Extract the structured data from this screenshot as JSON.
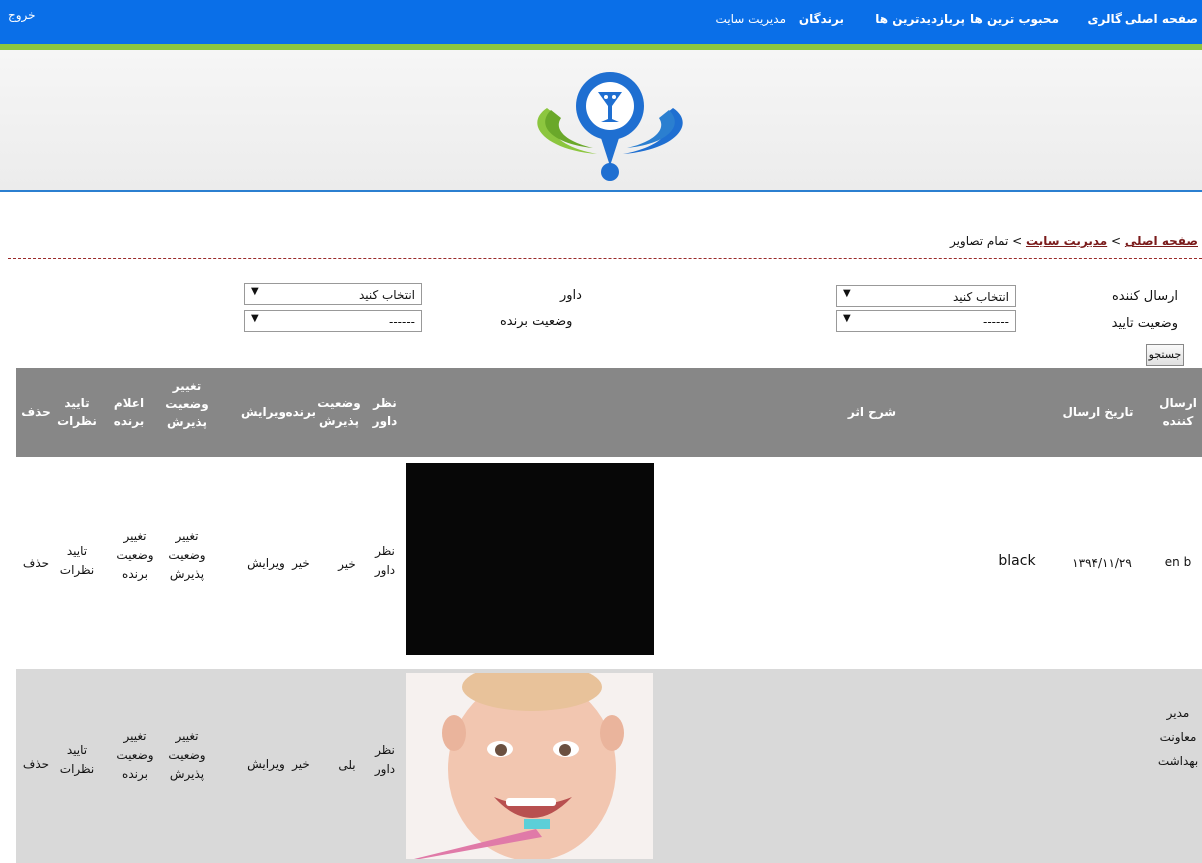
{
  "nav": {
    "items": [
      "صفحه اصلی",
      "گالری",
      "محبوب ترین ها",
      "پربازدیدترین ها",
      "برندگان",
      "مدیریت سایت"
    ],
    "logout": "خروج"
  },
  "colors": {
    "nav_bg": "#0a6fe8",
    "nav_accent": "#8cc63f",
    "header_bg": "#878787",
    "row_alt": "#d9d9d9",
    "link": "#7a1b1b"
  },
  "breadcrumb": {
    "home": "صفحه اصلی",
    "sep1": " > ",
    "admin": "مدیریت سایت",
    "sep2": " > ",
    "current": "تمام تصاویر"
  },
  "filters": {
    "sender_label": "ارسال کننده",
    "sender_value": "انتخاب کنید",
    "judge_label": "داور",
    "judge_value": "انتخاب کنید",
    "approval_label": "وضعیت تایید",
    "approval_value": "------",
    "winner_label": "وضعیت برنده",
    "winner_value": "------",
    "search_label": "جستجو",
    "dropdown_icon": "triangle-down"
  },
  "table": {
    "headers": {
      "sender": "ارسال کننده",
      "date": "تاریخ ارسال",
      "description": "شرح اثر",
      "judge_opinion": "نظر داور",
      "acceptance": "وضعیت پذیرش",
      "winner": "برنده",
      "edit": "ویرایش",
      "change_acceptance": "تغییر وضعیت پذیرش",
      "announce_winner": "اعلام برنده",
      "approve_comments": "تایید نظرات",
      "delete": "حذف"
    },
    "rows": [
      {
        "sender": "en b",
        "date": "۱۳۹۴/۱۱/۲۹",
        "description": "black",
        "judge_opinion": "نظر داور",
        "acceptance": "خیر",
        "winner": "خیر",
        "edit": "ویرایش",
        "change_acceptance": "تغییر وضعیت پذیرش",
        "change_winner": "تغییر وضعیت برنده",
        "approve_comments": "تایید نظرات",
        "delete": "حذف"
      },
      {
        "sender": "مدیر معاونت بهداشت",
        "date": "",
        "description": "",
        "judge_opinion": "نظر داور",
        "acceptance": "بلی",
        "winner": "خیر",
        "edit": "ویرایش",
        "change_acceptance": "تغییر وضعیت پذیرش",
        "change_winner": "تغییر وضعیت برنده",
        "approve_comments": "تایید نظرات",
        "delete": "حذف"
      }
    ]
  }
}
